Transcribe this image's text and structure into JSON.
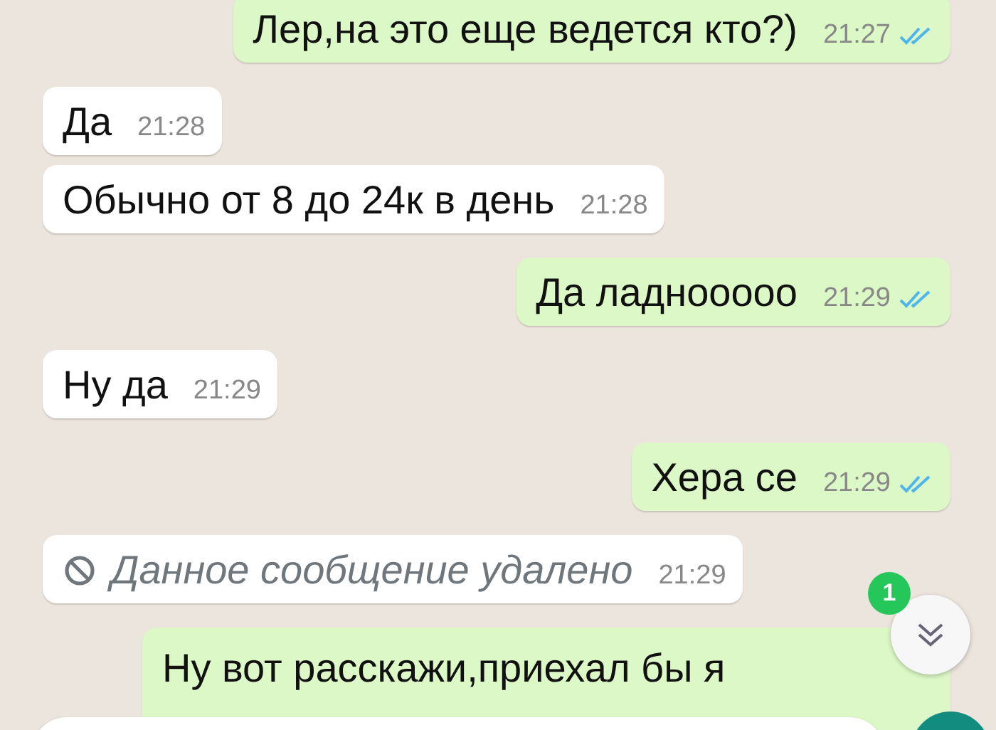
{
  "messages": [
    {
      "kind": "text",
      "outgoing": true,
      "text": "Лер,на это еще ведется кто?)",
      "time": "21:27",
      "read": true
    },
    {
      "kind": "text",
      "outgoing": false,
      "text": "Да",
      "time": "21:28"
    },
    {
      "kind": "text",
      "outgoing": false,
      "text": "Обычно от 8 до 24к в день",
      "time": "21:28"
    },
    {
      "kind": "text",
      "outgoing": true,
      "text": "Да ладнооооо",
      "time": "21:29",
      "read": true
    },
    {
      "kind": "text",
      "outgoing": false,
      "text": "Ну да",
      "time": "21:29"
    },
    {
      "kind": "text",
      "outgoing": true,
      "text": "Хера се",
      "time": "21:29",
      "read": true
    },
    {
      "kind": "deleted",
      "outgoing": false,
      "text": "Данное сообщение удалено",
      "time": "21:29"
    },
    {
      "kind": "partial",
      "outgoing": true,
      "text": "Ну вот расскажи,приехал бы я"
    }
  ],
  "scroll_button": {
    "unread_count": "1"
  }
}
